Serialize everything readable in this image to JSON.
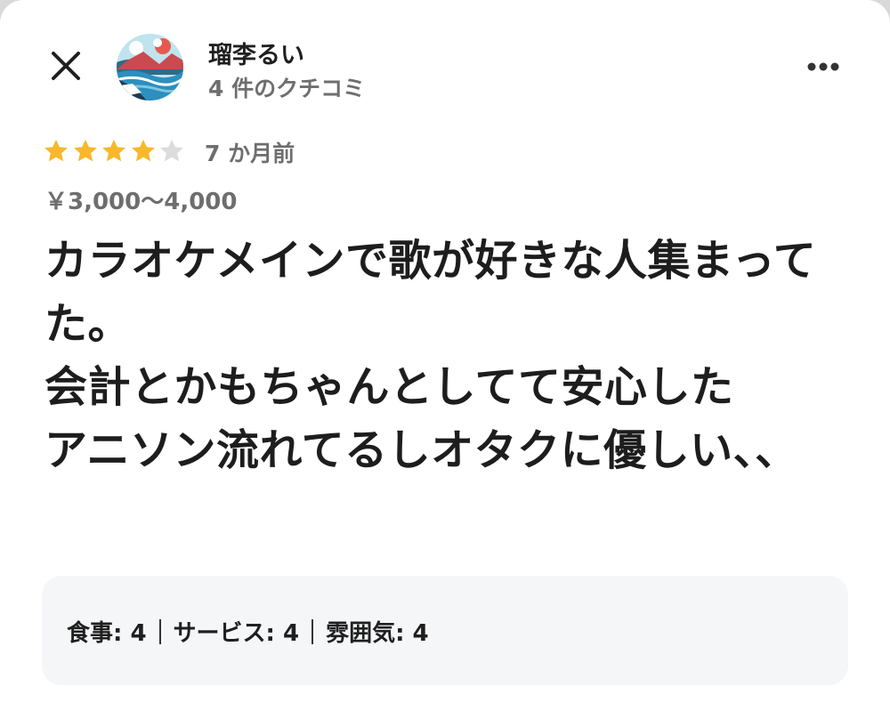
{
  "header": {
    "user_name": "瑠李るい",
    "review_count": "4 件のクチコミ"
  },
  "review": {
    "rating": 4,
    "max_rating": 5,
    "time_ago": "7 か月前",
    "price": "￥3,000～4,000",
    "body": "カラオケメインで歌が好きな人集まってた。\n会計とかもちゃんとしてて安心した\nアニソン流れてるしオタクに優しい、、"
  },
  "sub_ratings": [
    {
      "label": "食事: 4"
    },
    {
      "label": "サービス: 4"
    },
    {
      "label": "雰囲気: 4"
    }
  ],
  "colors": {
    "star_filled": "#f7b82b",
    "star_empty": "#dcdcdc",
    "text_primary": "#1d1d1d",
    "text_secondary": "#6e6e6e",
    "panel_bg": "#f5f6f8"
  },
  "icons": {
    "close": "close-icon",
    "more": "more-horizontal-icon",
    "star": "star-icon"
  }
}
